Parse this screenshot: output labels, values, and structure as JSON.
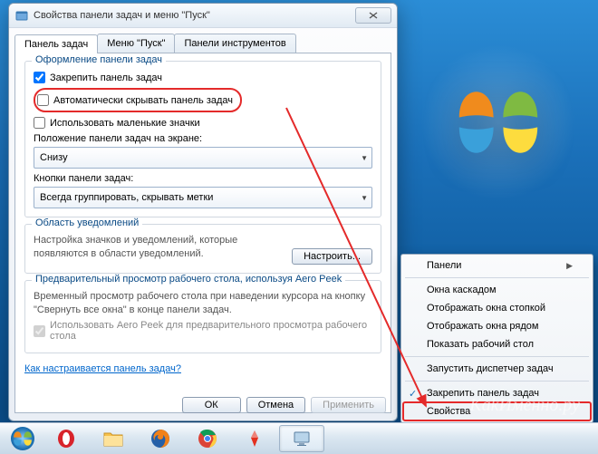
{
  "dialog": {
    "title": "Свойства панели задач и меню \"Пуск\"",
    "tabs": [
      "Панель задач",
      "Меню \"Пуск\"",
      "Панели инструментов"
    ],
    "groupAppearance": {
      "title": "Оформление панели задач",
      "lockTaskbar": "Закрепить панель задач",
      "autoHide": "Автоматически скрывать панель задач",
      "smallIcons": "Использовать маленькие значки",
      "positionLabel": "Положение панели задач на экране:",
      "positionValue": "Снизу",
      "buttonsLabel": "Кнопки панели задач:",
      "buttonsValue": "Всегда группировать, скрывать метки"
    },
    "groupNotify": {
      "title": "Область уведомлений",
      "desc": "Настройка значков и уведомлений, которые появляются в области уведомлений.",
      "btn": "Настроить..."
    },
    "groupPeek": {
      "title": "Предварительный просмотр рабочего стола, используя Aero Peek",
      "desc": "Временный просмотр рабочего стола при наведении курсора на кнопку \"Свернуть все окна\" в конце панели задач.",
      "chk": "Использовать Aero Peek для предварительного просмотра рабочего стола"
    },
    "helpLink": "Как настраивается панель задач?",
    "buttons": {
      "ok": "ОК",
      "cancel": "Отмена",
      "apply": "Применить"
    }
  },
  "context": {
    "panels": "Панели",
    "cascade": "Окна каскадом",
    "stack": "Отображать окна стопкой",
    "side": "Отображать окна рядом",
    "showDesktop": "Показать рабочий стол",
    "taskmgr": "Запустить диспетчер задач",
    "lock": "Закрепить панель задач",
    "props": "Свойства"
  },
  "watermark": "KakИменно.ру"
}
